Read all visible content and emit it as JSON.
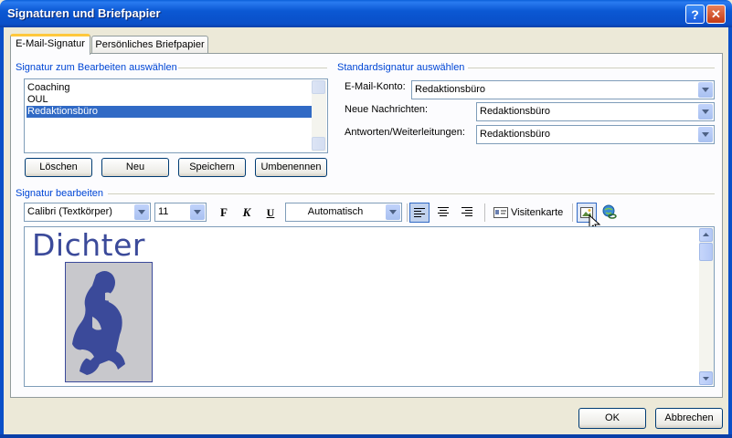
{
  "window": {
    "title": "Signaturen und Briefpapier",
    "help_label": "?",
    "close_label": "✕"
  },
  "tabs": [
    {
      "label": "E-Mail-Signatur",
      "active": true
    },
    {
      "label": "Persönliches Briefpapier",
      "active": false
    }
  ],
  "signature_select": {
    "heading": "Signatur zum Bearbeiten auswählen",
    "items": [
      "Coaching",
      "OUL",
      "Redaktionsbüro"
    ],
    "selected": "Redaktionsbüro",
    "buttons": {
      "delete": "Löschen",
      "new": "Neu",
      "save": "Speichern",
      "rename": "Umbenennen"
    }
  },
  "default_signature": {
    "heading": "Standardsignatur auswählen",
    "email_account_label": "E-Mail-Konto:",
    "email_account_value": "Redaktionsbüro",
    "new_messages_label": "Neue Nachrichten:",
    "new_messages_value": "Redaktionsbüro",
    "replies_label": "Antworten/Weiterleitungen:",
    "replies_value": "Redaktionsbüro"
  },
  "edit_signature": {
    "heading": "Signatur bearbeiten",
    "font": "Calibri (Textkörper)",
    "size": "11",
    "bold": "F",
    "italic": "K",
    "underline": "U",
    "color": "Automatisch",
    "business_card": "Visitenkarte",
    "content_text": "Dichter",
    "brand_color": "#3B4A9A"
  },
  "footer": {
    "ok": "OK",
    "cancel": "Abbrechen"
  },
  "icons": [
    "help-icon",
    "close-icon",
    "align-left-icon",
    "align-center-icon",
    "align-right-icon",
    "business-card-icon",
    "insert-picture-icon",
    "hyperlink-icon",
    "mouse-cursor-icon"
  ]
}
